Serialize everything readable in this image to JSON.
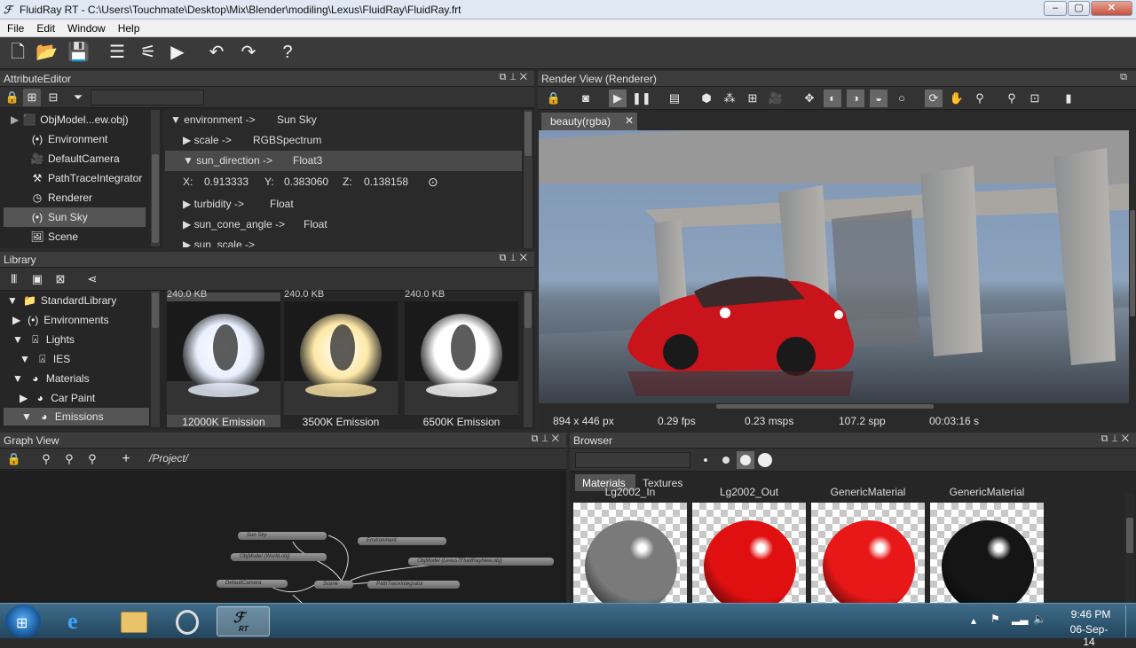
{
  "window": {
    "title": "FluidRay RT - C:\\Users\\Touchmate\\Desktop\\Mix\\Blender\\modiling\\Lexus\\FluidRay\\FluidRay.frt",
    "minimize": "‒",
    "maximize": "▢",
    "close": "✕"
  },
  "menu": [
    "File",
    "Edit",
    "Window",
    "Help"
  ],
  "attribute_editor": {
    "title": "AttributeEditor",
    "tree": [
      {
        "label": "ObjModel...ew.obj)",
        "icon": "object-icon"
      },
      {
        "label": "Environment",
        "icon": "environment-icon"
      },
      {
        "label": "DefaultCamera",
        "icon": "camera-icon"
      },
      {
        "label": "PathTraceIntegrator",
        "icon": "integrator-icon"
      },
      {
        "label": "Renderer",
        "icon": "renderer-icon"
      },
      {
        "label": "Sun Sky",
        "icon": "sunsky-icon",
        "selected": true
      },
      {
        "label": "Scene",
        "icon": "scene-icon"
      }
    ],
    "attrs": [
      {
        "name": "environment ->",
        "type": "Sun Sky",
        "arrow": "▼"
      },
      {
        "name": "scale ->",
        "type": "RGBSpectrum",
        "arrow": "▶"
      },
      {
        "name": "sun_direction ->",
        "type": "Float3",
        "arrow": "▼"
      },
      {
        "name": "turbidity ->",
        "type": "Float",
        "arrow": "▶"
      },
      {
        "name": "sun_cone_angle ->",
        "type": "Float",
        "arrow": "▶"
      },
      {
        "name": "sun_scale ->",
        "type": "RGBSpectrum",
        "arrow": "▶"
      }
    ],
    "xyz": {
      "x_label": "X:",
      "x": "0.913333",
      "y_label": "Y:",
      "y": "0.383060",
      "z_label": "Z:",
      "z": "0.138158"
    }
  },
  "library": {
    "title": "Library",
    "tree": [
      {
        "label": "StandardLibrary",
        "arrow": "▼",
        "indent": 0,
        "icon": "folder-icon"
      },
      {
        "label": "Environments",
        "arrow": "▶",
        "indent": 1,
        "icon": "environment-icon"
      },
      {
        "label": "Lights",
        "arrow": "▼",
        "indent": 1,
        "icon": "light-icon"
      },
      {
        "label": "IES",
        "arrow": "▼",
        "indent": 2,
        "icon": "light-icon"
      },
      {
        "label": "Materials",
        "arrow": "▼",
        "indent": 1,
        "icon": "material-icon"
      },
      {
        "label": "Car Paint",
        "arrow": "▶",
        "indent": 2,
        "icon": "material-icon"
      },
      {
        "label": "Emissions",
        "arrow": "▼",
        "indent": 2,
        "icon": "material-icon",
        "selected": true
      }
    ],
    "items": [
      {
        "size": "240.0 KB",
        "label": "12000K Emission",
        "tint": "#e8f0ff"
      },
      {
        "size": "240.0 KB",
        "label": "3500K Emission",
        "tint": "#ffe9a8"
      },
      {
        "size": "240.0 KB",
        "label": "6500K Emission",
        "tint": "#ffffff"
      }
    ]
  },
  "render_view": {
    "title": "Render View (Renderer)",
    "tab": "beauty(rgba)",
    "tab_close": "✕",
    "status": {
      "resolution": "894 x 446 px",
      "fps": "0.29 fps",
      "msps": "0.23 msps",
      "spp": "107.2 spp",
      "time": "00:03:16 s"
    }
  },
  "graph_view": {
    "title": "Graph View",
    "path": "/Project/",
    "nodes": [
      "Sun Sky",
      "Environment",
      "ObjModel (World.obj)",
      "ObjModel (Lexus7FluidRayNew.obj)",
      "DefaultCamera",
      "Scene",
      "PathTraceIntegrator"
    ]
  },
  "browser": {
    "title": "Browser",
    "tabs": [
      "Materials",
      "Textures"
    ],
    "materials": [
      {
        "label": "Lg2002_In",
        "color": "#7a7a7a"
      },
      {
        "label": "Lg2002_Out",
        "color": "#e01010"
      },
      {
        "label": "GenericMaterial",
        "color": "#e81818"
      },
      {
        "label": "GenericMaterial",
        "color": "#151515"
      }
    ]
  },
  "taskbar": {
    "time": "9:46 PM",
    "date": "06-Sep-14",
    "app_label": "RT"
  }
}
